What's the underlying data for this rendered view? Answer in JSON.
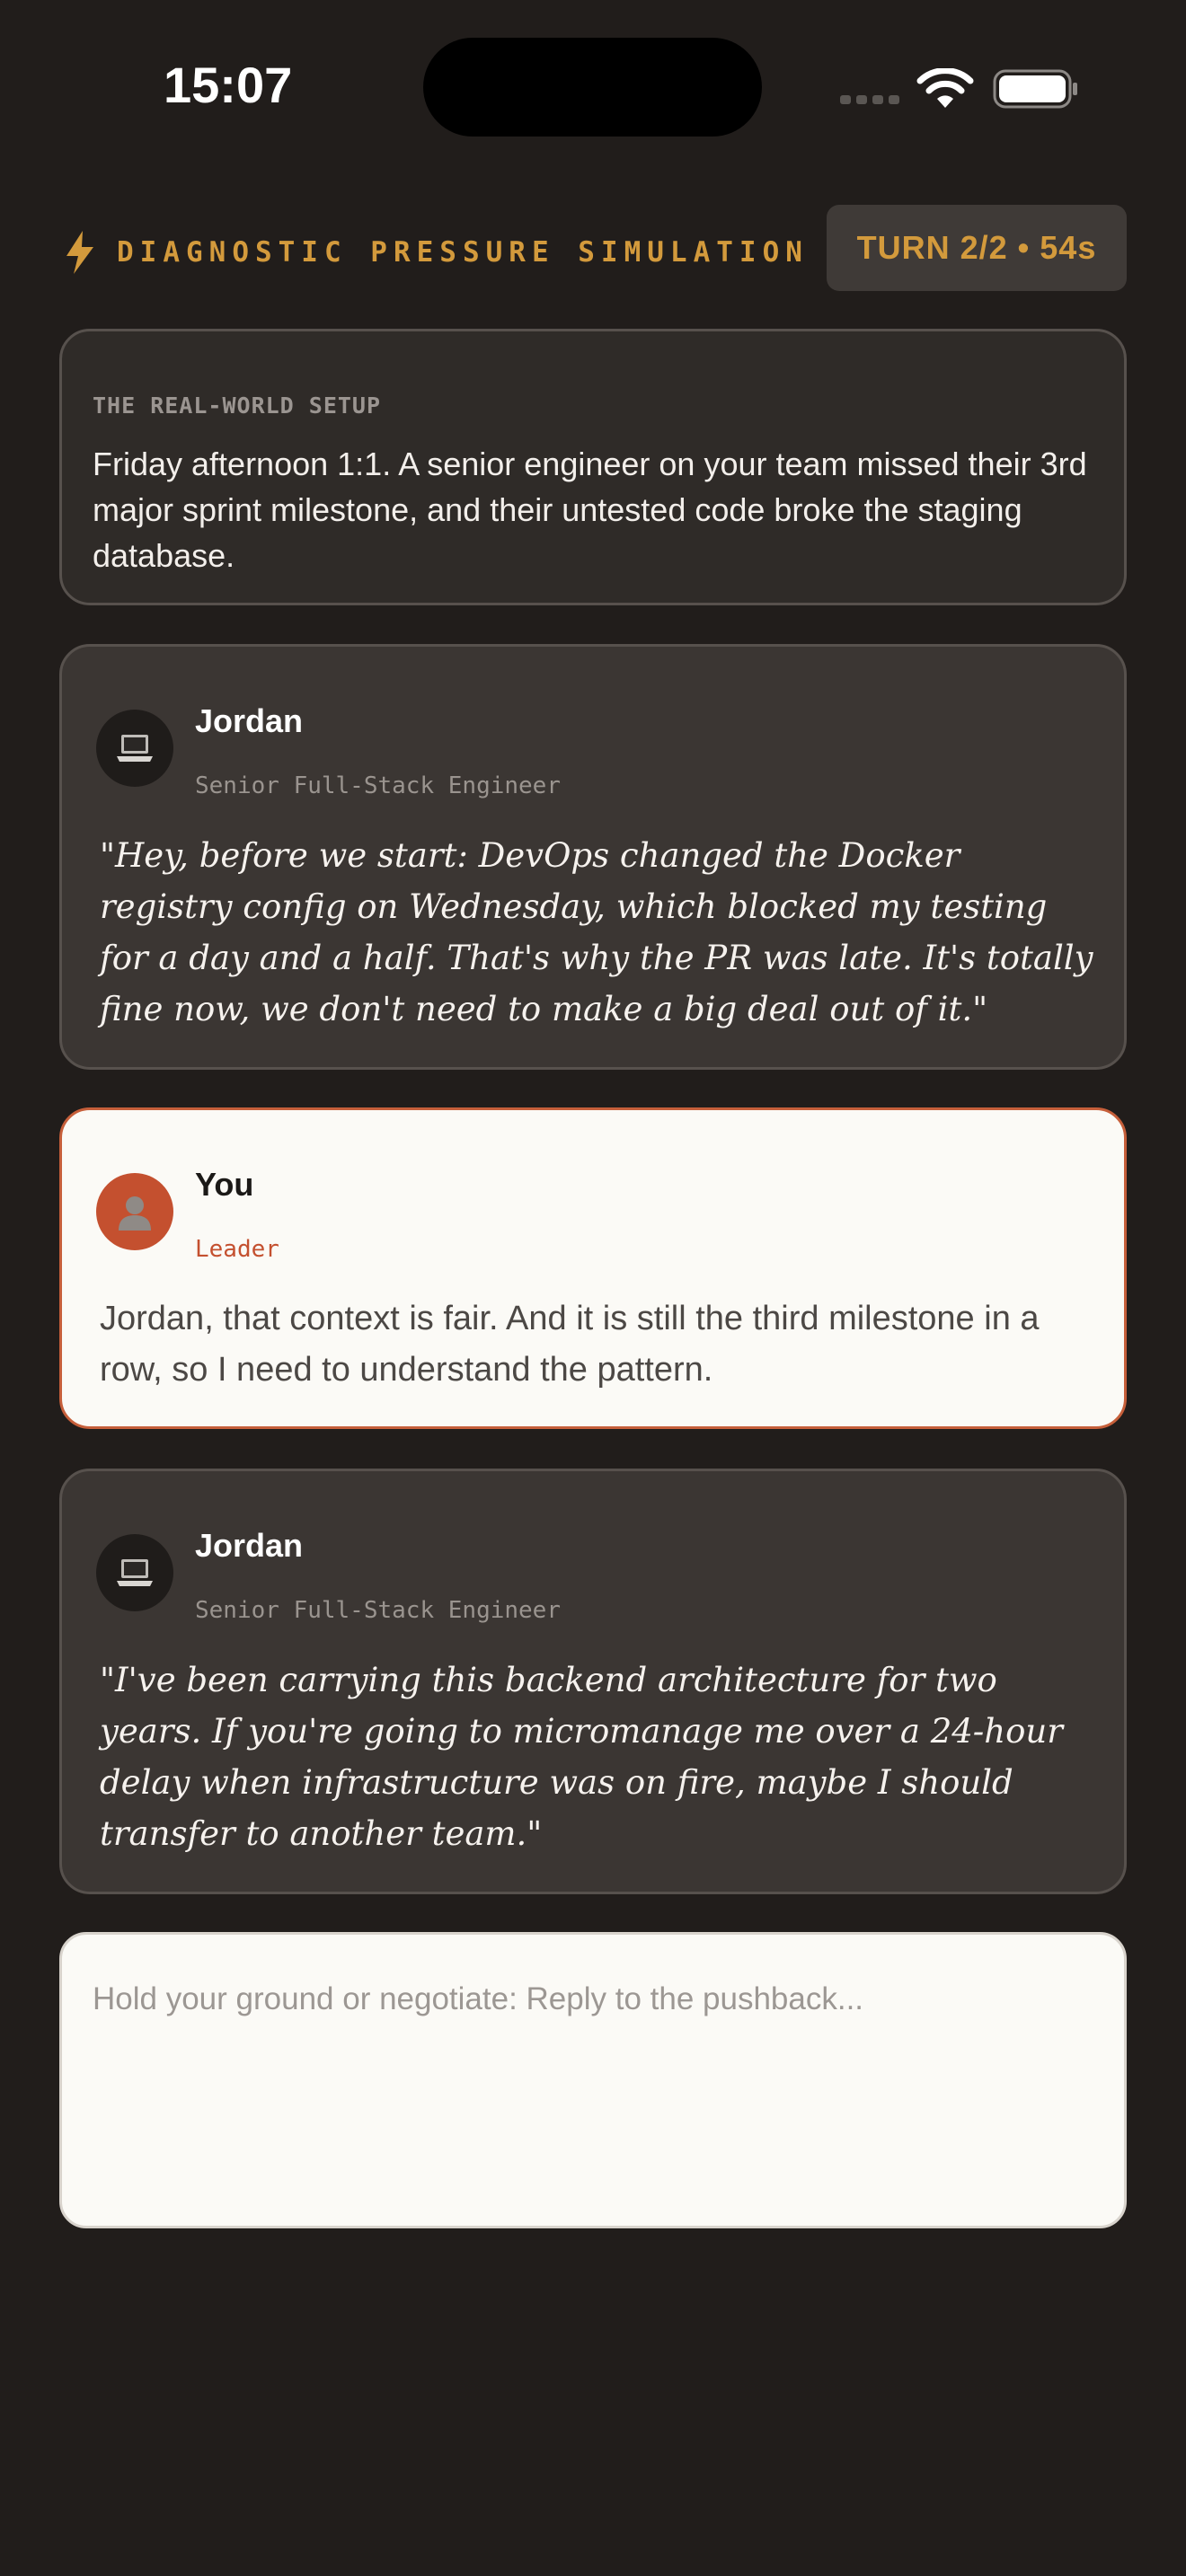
{
  "status_bar": {
    "time": "15:07"
  },
  "header": {
    "title": "DIAGNOSTIC PRESSURE SIMULATION",
    "icon": "lightning-bolt-icon",
    "turn_indicator": "TURN 2/2 • 54s"
  },
  "setup": {
    "label": "THE REAL-WORLD SETUP",
    "text": "Friday afternoon 1:1. A senior engineer on your team missed their 3rd major sprint milestone, and their untested code broke the staging database."
  },
  "conversation": [
    {
      "speaker": "Jordan",
      "role": "Senior Full-Stack Engineer",
      "avatar_icon": "laptop-icon",
      "text": "\"Hey, before we start: DevOps changed the Docker registry config on Wednesday, which blocked my testing for a day and a half. That's why the PR was late. It's totally fine now, we don't need to make a big deal out of it.\""
    },
    {
      "speaker": "You",
      "role": "Leader",
      "avatar_icon": "person-icon",
      "text": "Jordan, that context is fair. And it is still the third milestone in a row, so I need to understand the pattern."
    },
    {
      "speaker": "Jordan",
      "role": "Senior Full-Stack Engineer",
      "avatar_icon": "laptop-icon",
      "text": "\"I've been carrying this backend architecture for two years. If you're going to micromanage me over a 24-hour delay when infrastructure was on fire, maybe I should transfer to another team.\""
    }
  ],
  "reply": {
    "value": "",
    "placeholder": "Hold your ground or negotiate: Reply to the pushback..."
  },
  "colors": {
    "background": "#211d1b",
    "accent": "#d39a3c",
    "user_accent": "#c4502f",
    "card": "#3b3633"
  }
}
